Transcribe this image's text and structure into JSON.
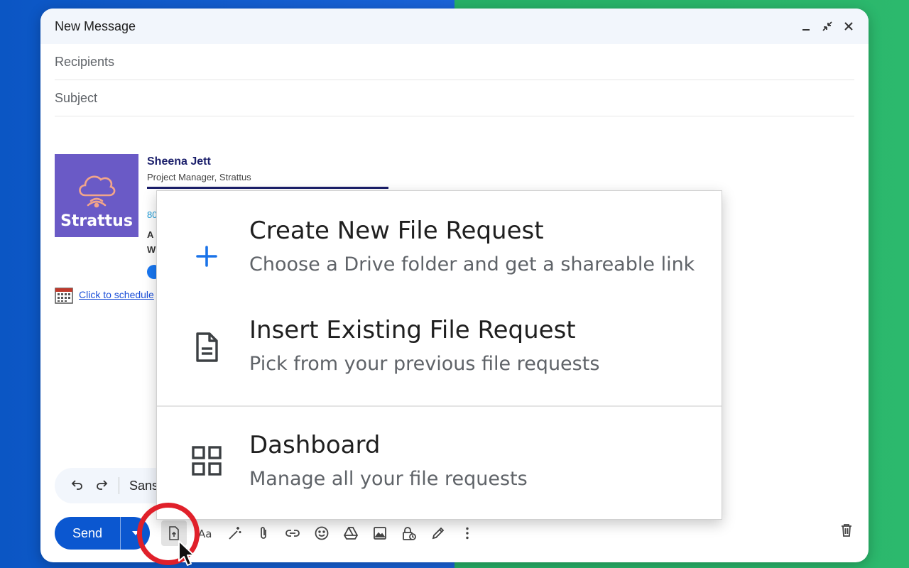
{
  "compose": {
    "title": "New Message",
    "recipients_placeholder": "Recipients",
    "subject_placeholder": "Subject"
  },
  "signature": {
    "logo_text": "Strattus",
    "name": "Sheena Jett",
    "role": "Project Manager, Strattus",
    "phone_peek": "80",
    "addr_peek_1": "A",
    "addr_peek_2": "W",
    "schedule_link": "Click to schedule"
  },
  "format_bar": {
    "font_label": "Sans"
  },
  "send": {
    "label": "Send"
  },
  "menu": {
    "items": [
      {
        "title": "Create New File Request",
        "subtitle": "Choose a Drive folder and get a shareable link",
        "icon": "plus-icon"
      },
      {
        "title": "Insert Existing File Request",
        "subtitle": "Pick from your previous file requests",
        "icon": "document-icon"
      },
      {
        "title": "Dashboard",
        "subtitle": "Manage all your file requests",
        "icon": "grid-icon"
      }
    ]
  },
  "colors": {
    "send_blue": "#0b57d0",
    "plus_blue": "#1a73e8",
    "logo_purple": "#6a5ac6",
    "highlight_ring": "#e0202a"
  }
}
